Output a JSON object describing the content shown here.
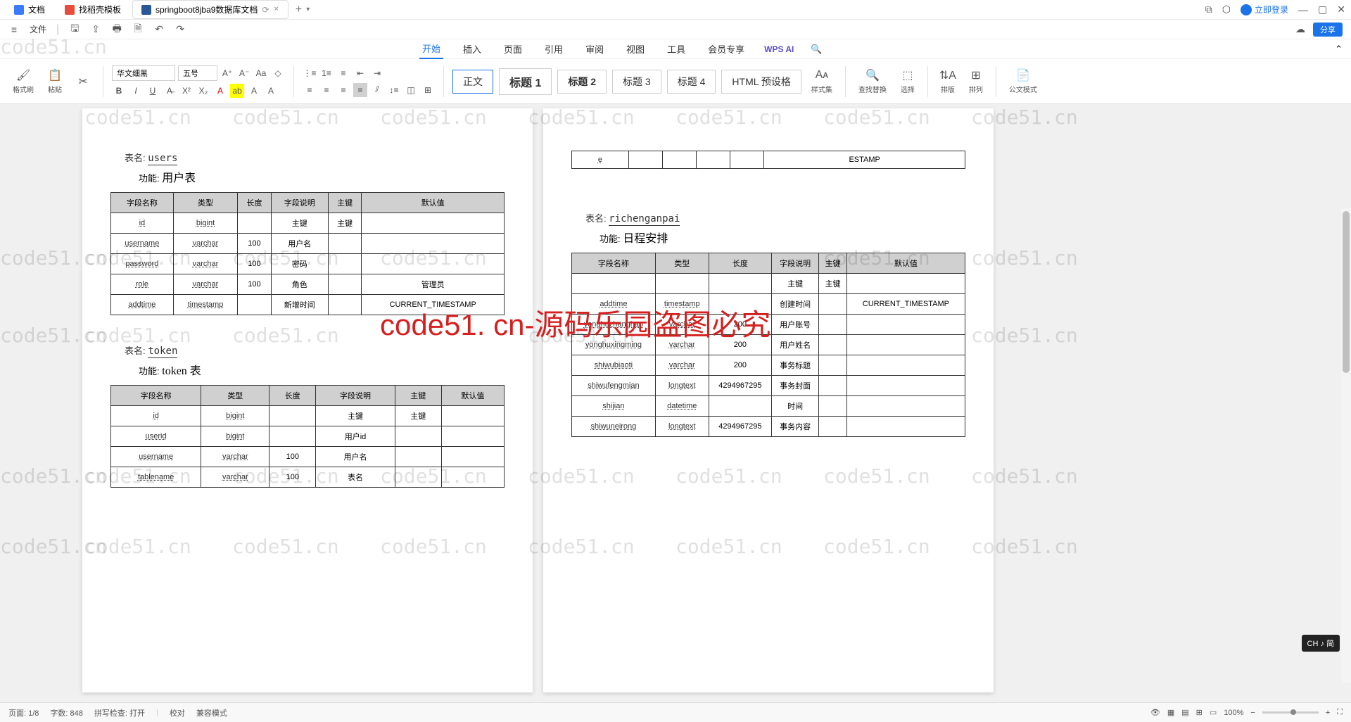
{
  "tabs": [
    {
      "label": "文档",
      "icon": "blue"
    },
    {
      "label": "找稻壳模板",
      "icon": "red"
    },
    {
      "label": "springboot8jba9数据库文档",
      "icon": "docblue",
      "active": true
    }
  ],
  "title_right": {
    "login": "立即登录"
  },
  "quick": {
    "file": "文件"
  },
  "menu": {
    "items": [
      "开始",
      "插入",
      "页面",
      "引用",
      "审阅",
      "视图",
      "工具",
      "会员专享"
    ],
    "active": "开始",
    "wpsai": "WPS AI"
  },
  "ribbon": {
    "format_painter": "格式刷",
    "paste": "粘贴",
    "font": "华文细黑",
    "size": "五号",
    "styles": {
      "body": "正文",
      "h1": "标题 1",
      "h2": "标题 2",
      "h3": "标题 3",
      "h4": "标题 4",
      "html": "HTML 预设格"
    },
    "styleset": "样式集",
    "findrepl": "查找替换",
    "select": "选择",
    "sort": "排版",
    "arrange": "排列",
    "officemode": "公文模式"
  },
  "share": "分享",
  "doc": {
    "p1": {
      "t1": {
        "name_label": "表名:",
        "name": "users",
        "func_label": "功能:",
        "func": "用户表",
        "headers": [
          "字段名称",
          "类型",
          "长度",
          "字段说明",
          "主键",
          "默认值"
        ],
        "rows": [
          [
            "id",
            "bigint",
            "",
            "主键",
            "主键",
            ""
          ],
          [
            "username",
            "varchar",
            "100",
            "用户名",
            "",
            ""
          ],
          [
            "password",
            "varchar",
            "100",
            "密码",
            "",
            ""
          ],
          [
            "role",
            "varchar",
            "100",
            "角色",
            "",
            "管理员"
          ],
          [
            "addtime",
            "timestamp",
            "",
            "新增时间",
            "",
            "CURRENT_TIMESTAMP"
          ]
        ]
      },
      "t2": {
        "name_label": "表名:",
        "name": "token",
        "func_label": "功能:",
        "func": "token 表",
        "headers": [
          "字段名称",
          "类型",
          "长度",
          "字段说明",
          "主键",
          "默认值"
        ],
        "rows": [
          [
            "id",
            "bigint",
            "",
            "主键",
            "主键",
            ""
          ],
          [
            "userid",
            "bigint",
            "",
            "用户id",
            "",
            ""
          ],
          [
            "username",
            "varchar",
            "100",
            "用户名",
            "",
            ""
          ],
          [
            "tablename",
            "varchar",
            "100",
            "表名",
            "",
            ""
          ]
        ]
      }
    },
    "p2": {
      "frag": {
        "rows": [
          [
            "e",
            "",
            "",
            "",
            "",
            "ESTAMP"
          ]
        ]
      },
      "t1": {
        "name_label": "表名:",
        "name": "richenganpai",
        "func_label": "功能:",
        "func": "日程安排",
        "headers": [
          "字段名称",
          "类型",
          "长度",
          "字段说明",
          "主键",
          "默认值"
        ],
        "rows": [
          [
            "",
            "",
            "",
            "主键",
            "主键",
            ""
          ],
          [
            "addtime",
            "timestamp",
            "",
            "创建时间",
            "",
            "CURRENT_TIMESTAMP"
          ],
          [
            "yonghuzhanghao",
            "varchar",
            "200",
            "用户账号",
            "",
            ""
          ],
          [
            "yonghuxingming",
            "varchar",
            "200",
            "用户姓名",
            "",
            ""
          ],
          [
            "shiwubiaoti",
            "varchar",
            "200",
            "事务标题",
            "",
            ""
          ],
          [
            "shiwufengmian",
            "longtext",
            "4294967295",
            "事务封面",
            "",
            ""
          ],
          [
            "shijian",
            "datetime",
            "",
            "时间",
            "",
            ""
          ],
          [
            "shiwuneirong",
            "longtext",
            "4294967295",
            "事务内容",
            "",
            ""
          ]
        ]
      }
    }
  },
  "wm_red": "code51. cn-源码乐园盗图必究",
  "lang": "CH ♪ 简",
  "status": {
    "page": "页面: 1/8",
    "words": "字数: 848",
    "spell": "拼写检查: 打开",
    "proof": "校对",
    "compat": "兼容模式",
    "zoom": "100%"
  }
}
